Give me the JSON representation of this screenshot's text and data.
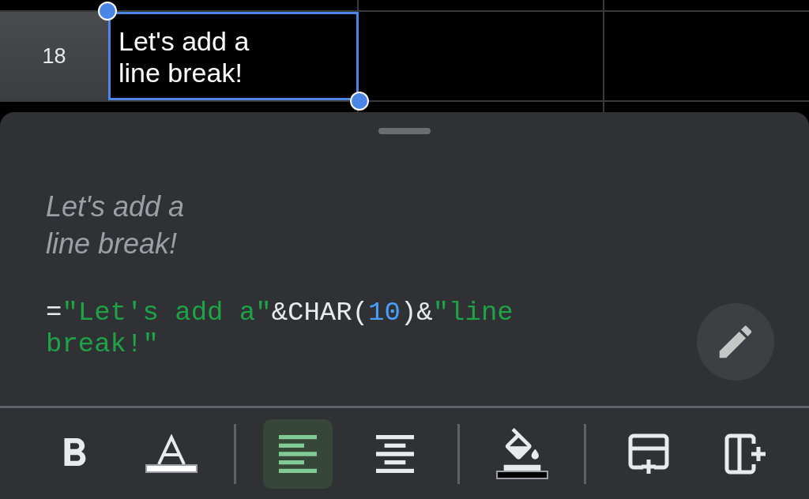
{
  "grid": {
    "row_label": "18",
    "cell_text": "Let's add a\nline break!",
    "cell_selected": true
  },
  "sheet": {
    "preview": "Let's add a\nline break!",
    "formula": [
      {
        "kind": "operator",
        "text": "="
      },
      {
        "kind": "string",
        "text": "\"Let's add a\""
      },
      {
        "kind": "operator",
        "text": "&CHAR("
      },
      {
        "kind": "number",
        "text": "10"
      },
      {
        "kind": "operator",
        "text": ")&"
      },
      {
        "kind": "string",
        "text": "\"line break!\""
      }
    ]
  },
  "toolbar": [
    {
      "kind": "bold",
      "selected": false
    },
    {
      "kind": "text-color",
      "selected": false,
      "color": "#ffffff"
    },
    {
      "kind": "separator"
    },
    {
      "kind": "align-left",
      "selected": true
    },
    {
      "kind": "align-center",
      "selected": false
    },
    {
      "kind": "separator"
    },
    {
      "kind": "fill-color",
      "selected": false,
      "color": "#000000"
    },
    {
      "kind": "separator"
    },
    {
      "kind": "insert-row",
      "selected": false
    },
    {
      "kind": "insert-column",
      "selected": false
    }
  ]
}
